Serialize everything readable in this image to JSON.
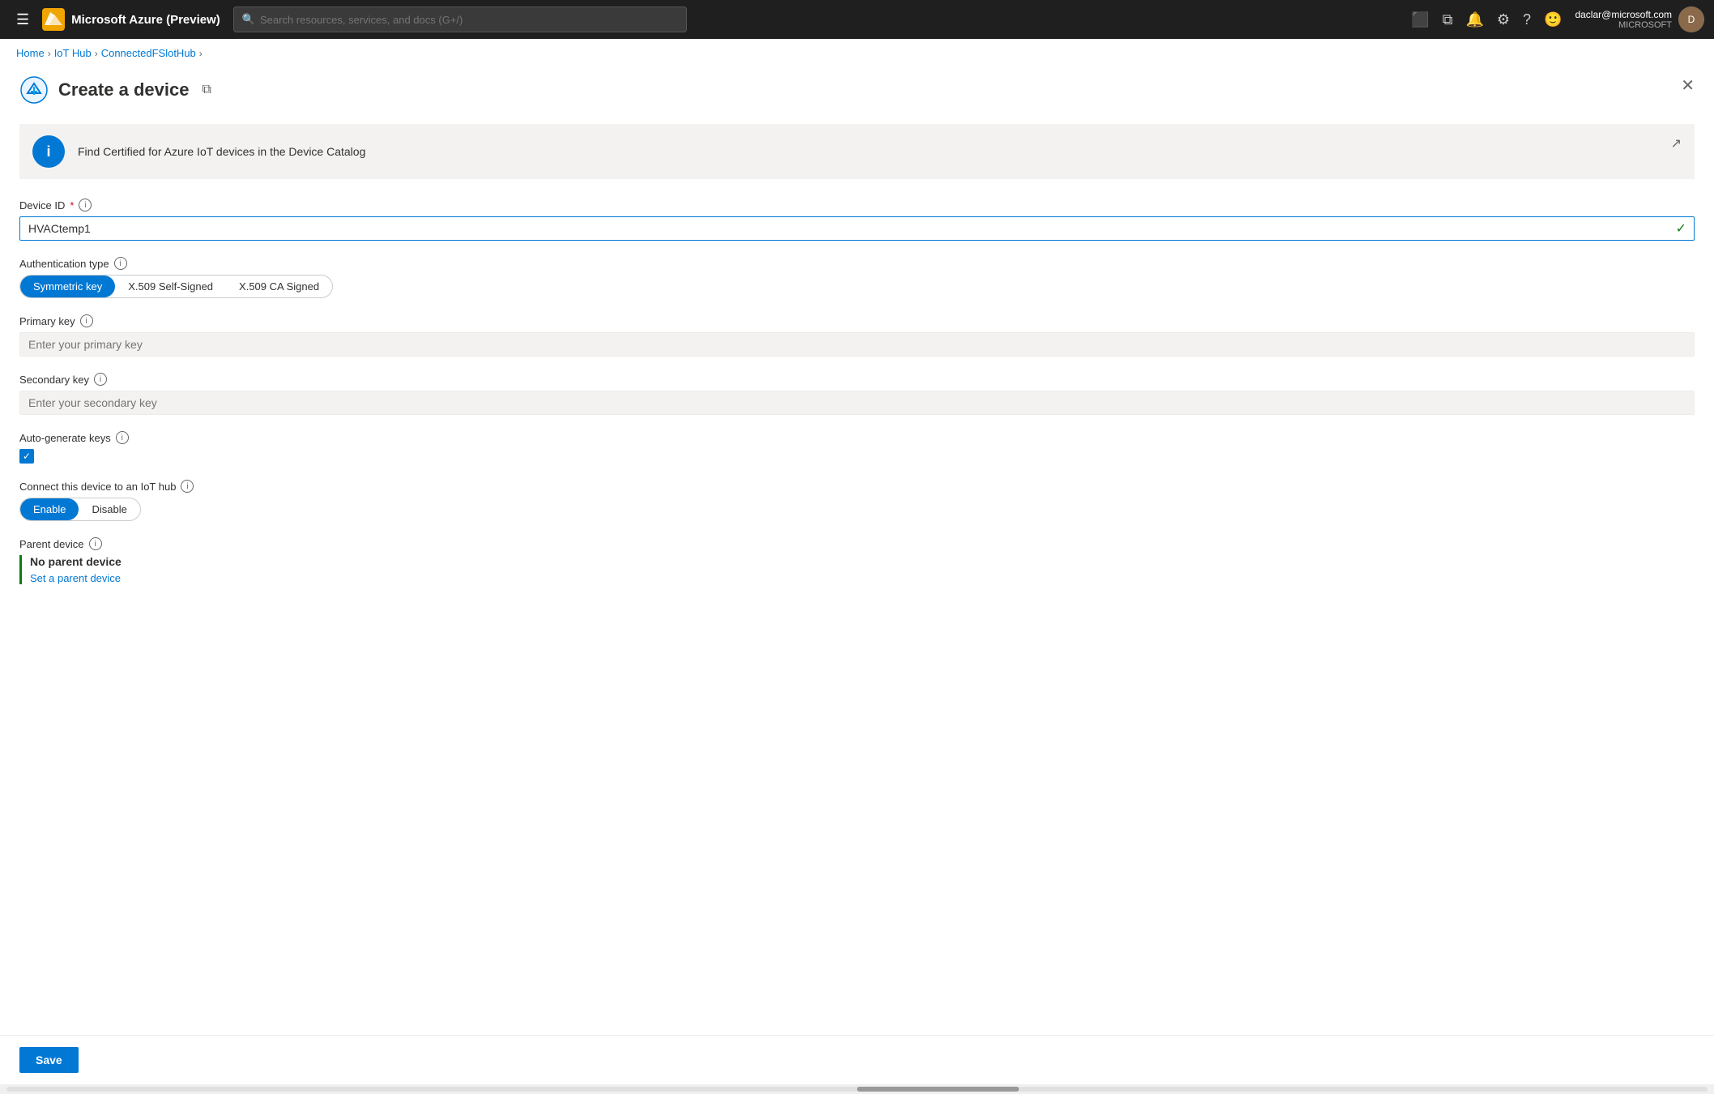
{
  "topnav": {
    "brand": "Microsoft Azure (Preview)",
    "search_placeholder": "Search resources, services, and docs (G+/)",
    "user_email": "daclar@microsoft.com",
    "user_org": "MICROSOFT"
  },
  "breadcrumb": {
    "items": [
      "Home",
      "IoT Hub",
      "ConnectedFSlotHub"
    ]
  },
  "page": {
    "title": "Create a device",
    "info_banner": "Find Certified for Azure IoT devices in the Device Catalog"
  },
  "form": {
    "device_id_label": "Device ID",
    "device_id_value": "HVACtemp1",
    "auth_type_label": "Authentication type",
    "auth_options": [
      "Symmetric key",
      "X.509 Self-Signed",
      "X.509 CA Signed"
    ],
    "auth_selected": "Symmetric key",
    "primary_key_label": "Primary key",
    "primary_key_placeholder": "Enter your primary key",
    "secondary_key_label": "Secondary key",
    "secondary_key_placeholder": "Enter your secondary key",
    "auto_generate_label": "Auto-generate keys",
    "connect_iot_label": "Connect this device to an IoT hub",
    "connect_options": [
      "Enable",
      "Disable"
    ],
    "connect_selected": "Enable",
    "parent_device_label": "Parent device",
    "parent_device_value": "No parent device",
    "set_parent_link": "Set a parent device"
  },
  "actions": {
    "save_label": "Save"
  },
  "icons": {
    "hamburger": "☰",
    "search": "🔍",
    "cloud_shell": "⬛",
    "portal_settings": "⚙",
    "notifications": "🔔",
    "settings": "⚙",
    "help": "?",
    "feedback": "🙂",
    "external_link": "↗",
    "close": "✕",
    "info": "i",
    "check": "✓",
    "breadcrumb_sep": "›"
  }
}
